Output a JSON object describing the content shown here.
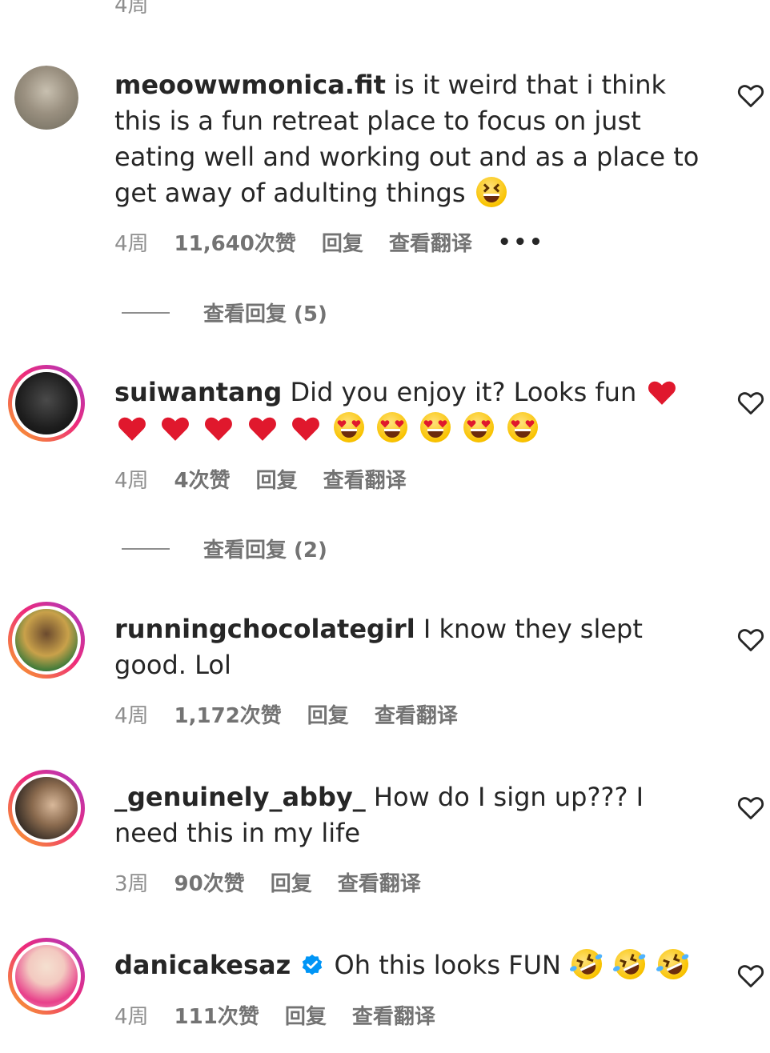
{
  "top_cut_timestamp": "4周",
  "comments": [
    {
      "username": "meoowwmonica.fit",
      "body": "is it weird that i think this is a fun retreat place to focus on just eating well and working out and as a place to get away of adulting things",
      "emojis": [
        "grinning-squinting-face"
      ],
      "age": "4周",
      "likes": "11,640次赞",
      "reply": "回复",
      "translate": "查看翻译",
      "more": "•••",
      "view_replies": "查看回复 (5)"
    },
    {
      "username": "suiwantang",
      "body": "Did you enjoy it? Looks fun",
      "emojis": [
        "heart",
        "heart",
        "heart",
        "heart",
        "heart",
        "heart",
        "heart-eyes",
        "heart-eyes",
        "heart-eyes",
        "heart-eyes",
        "heart-eyes"
      ],
      "age": "4周",
      "likes": "4次赞",
      "reply": "回复",
      "translate": "查看翻译",
      "view_replies": "查看回复 (2)"
    },
    {
      "username": "runningchocolategirl",
      "body": "I know they slept good. Lol",
      "age": "4周",
      "likes": "1,172次赞",
      "reply": "回复",
      "translate": "查看翻译"
    },
    {
      "username": "_genuinely_abby_",
      "body": "How do I sign up??? I need this in my life",
      "age": "3周",
      "likes": "90次赞",
      "reply": "回复",
      "translate": "查看翻译"
    },
    {
      "username": "danicakesaz",
      "verified": true,
      "body": "Oh this looks FUN",
      "emojis": [
        "rolling-on-floor-laughing",
        "rolling-on-floor-laughing",
        "rolling-on-floor-laughing"
      ],
      "age": "4周",
      "likes": "111次赞",
      "reply": "回复",
      "translate": "查看翻译"
    }
  ],
  "colors": {
    "text": "#262626",
    "muted": "#8e8e8e",
    "verified": "#0095f6",
    "story_ring": [
      "#f9a825",
      "#ee2a7b",
      "#a33bc9"
    ],
    "heart_emoji": "#e0182d"
  }
}
